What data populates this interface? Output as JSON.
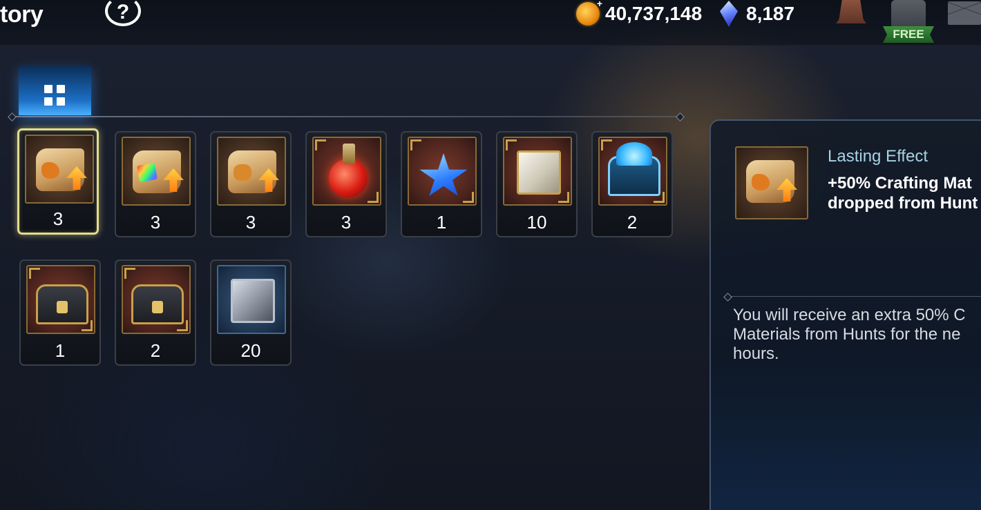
{
  "header": {
    "title": "tory",
    "help_label": "?",
    "gold": "40,737,148",
    "gems": "8,187",
    "plus": "+",
    "free_label": "FREE"
  },
  "tabs": [
    {
      "label": "",
      "icon": "grid-icon",
      "selected": true
    }
  ],
  "items": [
    {
      "icon": "scroll-fire-icon",
      "count": "3",
      "selected": true
    },
    {
      "icon": "scroll-rainbow-icon",
      "count": "3"
    },
    {
      "icon": "scroll-coin-icon",
      "count": "3"
    },
    {
      "icon": "red-potion-icon",
      "count": "3"
    },
    {
      "icon": "star-potion-icon",
      "count": "1"
    },
    {
      "icon": "gold-cube-icon",
      "count": "10"
    },
    {
      "icon": "blue-chest-icon",
      "count": "2"
    },
    {
      "icon": "dark-chest-icon",
      "count": "1"
    },
    {
      "icon": "dark-chest-icon",
      "count": "2"
    },
    {
      "icon": "silver-cube-icon",
      "count": "20"
    }
  ],
  "detail": {
    "type": "Lasting Effect",
    "name": "+50% Crafting Mat\ndropped from Hunt",
    "description": "You will receive an extra 50% C\nMaterials from Hunts for the ne\nhours."
  },
  "colors": {
    "selected_border": "#e4dc8a",
    "tab_accent": "#1b6ec4",
    "detail_type": "#a7d3e4"
  }
}
